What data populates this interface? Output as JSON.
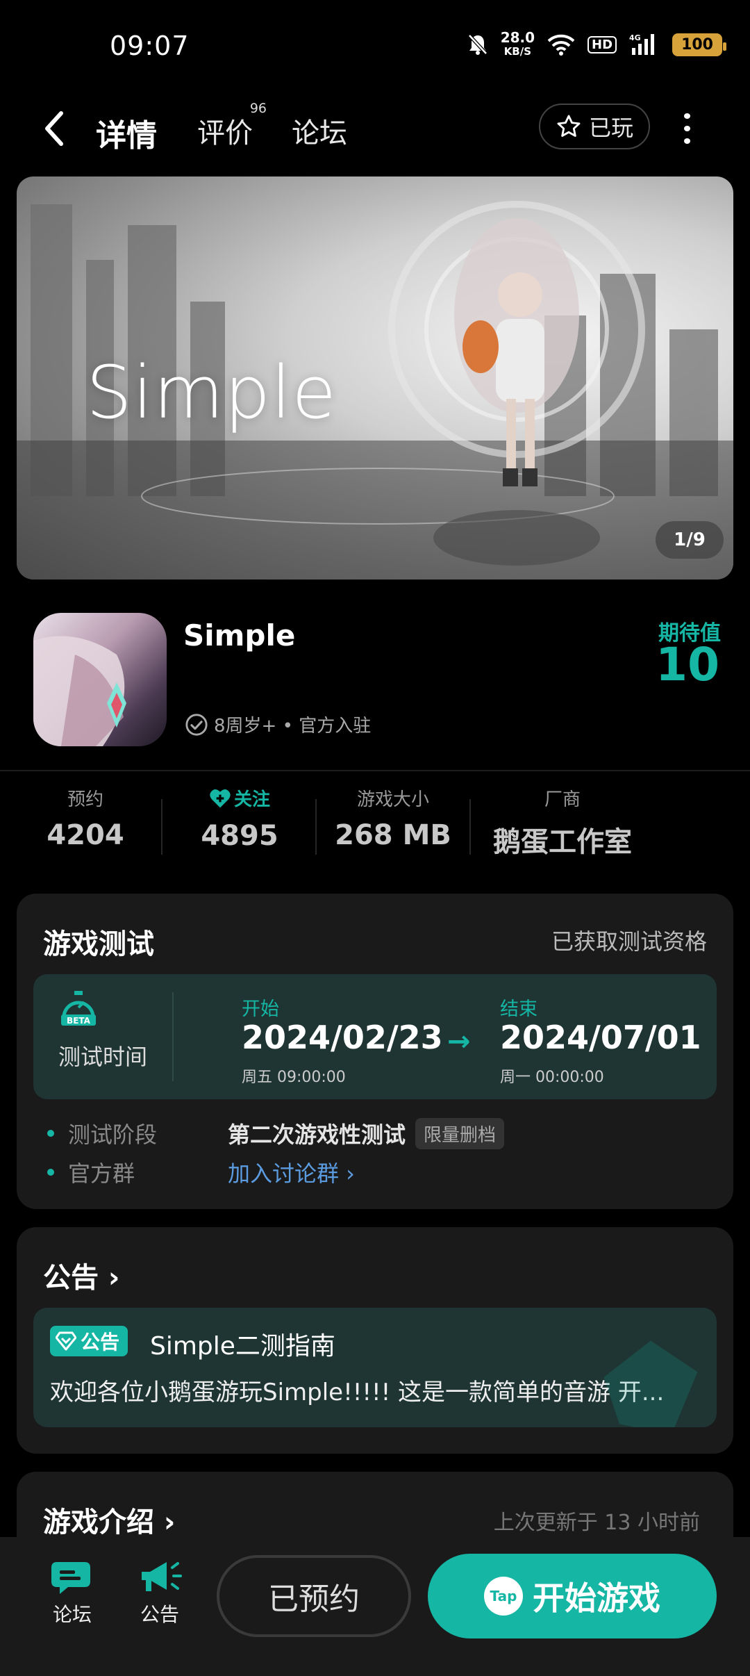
{
  "status_bar": {
    "time": "09:07",
    "net_speed": "28.0",
    "net_unit": "KB/S",
    "hd": "HD",
    "network": "4G",
    "battery": "100"
  },
  "nav": {
    "tabs": [
      {
        "label": "详情"
      },
      {
        "label": "评价",
        "badge": "96"
      },
      {
        "label": "论坛"
      }
    ],
    "played_label": "已玩"
  },
  "banner": {
    "title": "Simple",
    "counter": "1/9"
  },
  "game": {
    "name": "Simple",
    "meta": "8周岁+ • 官方入驻",
    "expect_label": "期待值",
    "expect_value": "10"
  },
  "stats": [
    {
      "label": "预约",
      "value": "4204"
    },
    {
      "label": "关注",
      "value": "4895"
    },
    {
      "label": "游戏大小",
      "value": "268 MB"
    },
    {
      "label": "厂商",
      "value": "鹅蛋工作室"
    }
  ],
  "test": {
    "title": "游戏测试",
    "qualification": "已获取测试资格",
    "time_label": "测试时间",
    "beta": "BETA",
    "start_label": "开始",
    "start_date": "2024/02/23",
    "start_sub": "周五  09:00:00",
    "end_label": "结束",
    "end_date": "2024/07/01",
    "end_sub": "周一  00:00:00",
    "stage_key": "测试阶段",
    "stage_value": "第二次游戏性测试",
    "stage_tag": "限量删档",
    "group_key": "官方群",
    "group_link": "加入讨论群 ›"
  },
  "notice": {
    "title": "公告 ›",
    "tag": "公告",
    "item_title": "Simple二测指南",
    "item_body": "欢迎各位小鹅蛋游玩Simple!!!!! 这是一款简单的音游 开..."
  },
  "intro": {
    "title": "游戏介绍 ›",
    "updated": "上次更新于 13 小时前"
  },
  "bottom": {
    "forum": "论坛",
    "notice": "公告",
    "reserved": "已预约",
    "play": "开始游戏",
    "tap_logo": "Tap"
  },
  "colors": {
    "accent": "#16b6a4",
    "card": "#1a1a1a",
    "link": "#5b9bdf",
    "battery": "#d7a23a"
  }
}
